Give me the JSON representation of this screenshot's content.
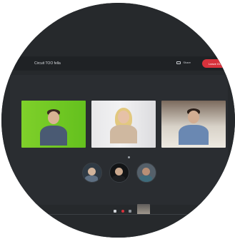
{
  "window": {
    "title": "Circuit TOO fella"
  },
  "toolbar": {
    "share_label": "Share",
    "leave_label": "Leave 01:31"
  },
  "participants": [
    {
      "shirt": "#4a5a73"
    },
    {
      "shirt": "#cfb8a0"
    },
    {
      "shirt": "#6a88b2"
    }
  ],
  "thumbnails": [
    {
      "bg": "#2f3a44",
      "head": "#d2b49b",
      "body": "#5e6f82"
    },
    {
      "bg": "#121416",
      "head": "#caa88e",
      "body": "#1d1f22"
    },
    {
      "bg": "#55606a",
      "head": "#b88f76",
      "body": "#3e6a7a"
    }
  ],
  "icons": {
    "mic": "mic-icon",
    "cam": "camera-off-icon",
    "more": "more-icon",
    "share": "screen-share-icon"
  },
  "colors": {
    "leave": "#d8323c",
    "background": "#26292c",
    "topbar": "#1f2225"
  }
}
